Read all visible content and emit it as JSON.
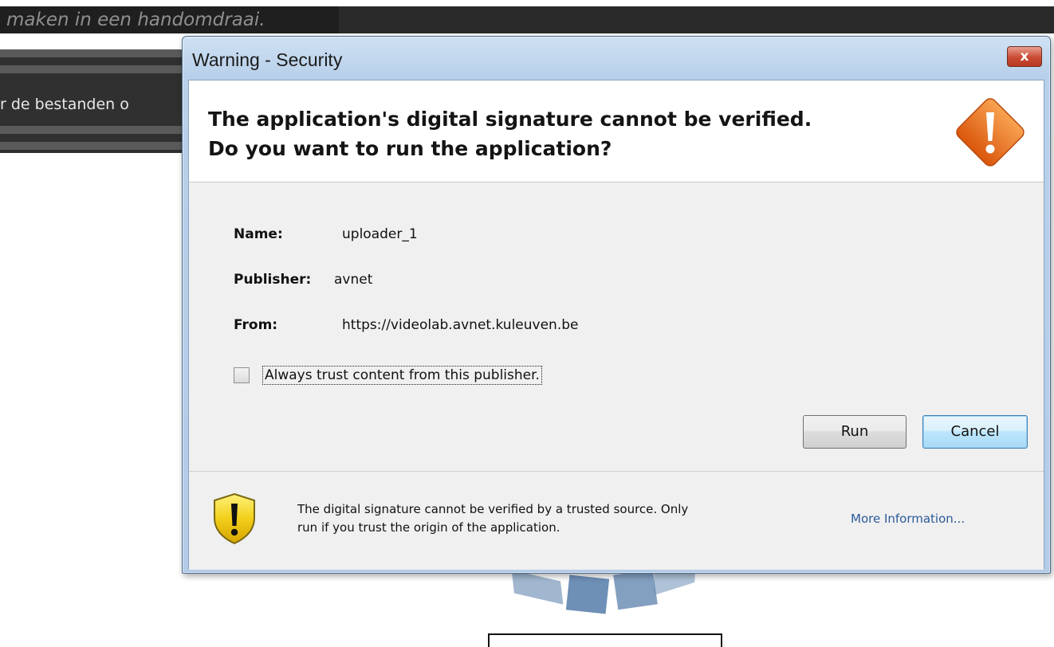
{
  "background": {
    "headline": "maken in een handomdraai.",
    "panel_text": "r de bestanden o"
  },
  "dialog": {
    "title": "Warning - Security",
    "close_glyph": "x",
    "heading_line1": "The application's digital signature cannot be verified.",
    "heading_line2": "Do you want to run the application?",
    "warning_icon": "warning-diamond-icon",
    "fields": {
      "name_label": "Name:",
      "name_value": "uploader_1",
      "publisher_label": "Publisher:",
      "publisher_value": "avnet",
      "from_label": "From:",
      "from_value": "https://videolab.avnet.kuleuven.be"
    },
    "trust_checkbox": {
      "label": "Always trust content from this publisher.",
      "checked": false
    },
    "buttons": {
      "run": "Run",
      "cancel": "Cancel"
    },
    "footer": {
      "shield_icon": "warning-shield-icon",
      "message_line1": "The digital signature cannot be verified by a trusted source.  Only",
      "message_line2": "run if you trust the origin of the application.",
      "more_info": "More Information..."
    }
  },
  "colors": {
    "warning_orange": "#ee7a1e",
    "shield_yellow": "#f2cf1a",
    "link_blue": "#2a5a9a",
    "spinner_blue": "#6e8fb6"
  }
}
